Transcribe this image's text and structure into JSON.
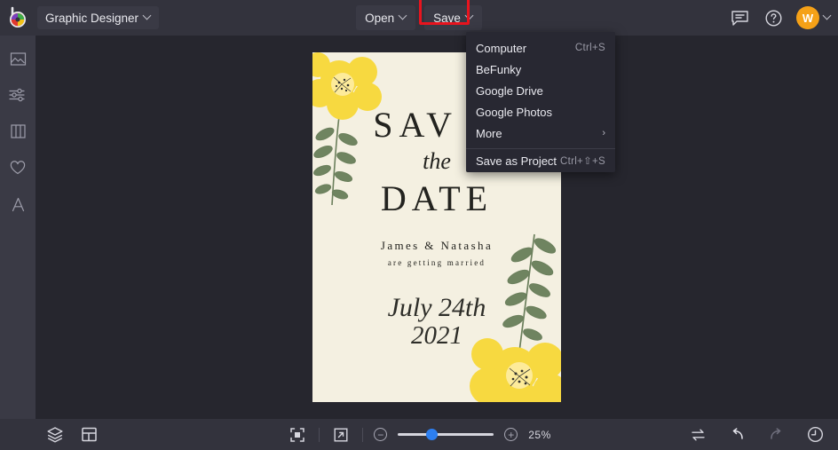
{
  "app": {
    "name": "BeFunky",
    "logo_icon": "befunky-color-wheel-logo"
  },
  "topbar": {
    "workspace_label": "Graphic Designer",
    "workspace_chevron_icon": "chevron-down-icon",
    "open_label": "Open",
    "save_label": "Save",
    "highlight_color": "#e8141e",
    "feedback_icon": "chat-bubble-icon",
    "help_icon": "question-mark-circle-icon",
    "avatar_initial": "W",
    "avatar_color": "#f5a117",
    "avatar_chevron_icon": "chevron-down-icon"
  },
  "save_menu": {
    "items": [
      {
        "label": "Computer",
        "shortcut": "Ctrl+S",
        "has_submenu": false
      },
      {
        "label": "BeFunky",
        "shortcut": "",
        "has_submenu": false
      },
      {
        "label": "Google Drive",
        "shortcut": "",
        "has_submenu": false
      },
      {
        "label": "Google Photos",
        "shortcut": "",
        "has_submenu": false
      },
      {
        "label": "More",
        "shortcut": "",
        "has_submenu": true,
        "submenu_icon": "chevron-right-icon"
      },
      {
        "label": "Save as Project",
        "shortcut": "Ctrl+⇧+S",
        "has_submenu": false
      }
    ]
  },
  "sidebar": {
    "items": [
      {
        "name": "image-manager",
        "icon": "image-icon"
      },
      {
        "name": "edit-adjust",
        "icon": "sliders-icon"
      },
      {
        "name": "templates",
        "icon": "columns-icon"
      },
      {
        "name": "graphics-favorites",
        "icon": "heart-icon"
      },
      {
        "name": "text-tool",
        "icon": "letter-a-icon"
      }
    ]
  },
  "canvas": {
    "design": {
      "line_save": "SAV E",
      "line_the": "the",
      "line_date": "DATE",
      "names": "James & Natasha",
      "subtitle": "are getting married",
      "event_month_day": "July 24th",
      "event_year": "2021",
      "background_color": "#f4f0e1",
      "flower_color": "#f5d63f",
      "leaf_color": "#6b7f5c"
    }
  },
  "bottombar": {
    "layers_icon": "layers-icon",
    "panel_icon": "layout-panel-icon",
    "fit_screen_icon": "fit-to-screen-icon",
    "fullscreen_icon": "expand-arrow-icon",
    "zoom_out_icon": "minus-icon",
    "zoom_in_icon": "plus-icon",
    "zoom_value": "25%",
    "zoom_percent": 25,
    "compare_icon": "swap-arrows-icon",
    "undo_icon": "undo-arrow-icon",
    "redo_icon": "redo-arrow-icon",
    "history_icon": "clock-history-icon"
  }
}
